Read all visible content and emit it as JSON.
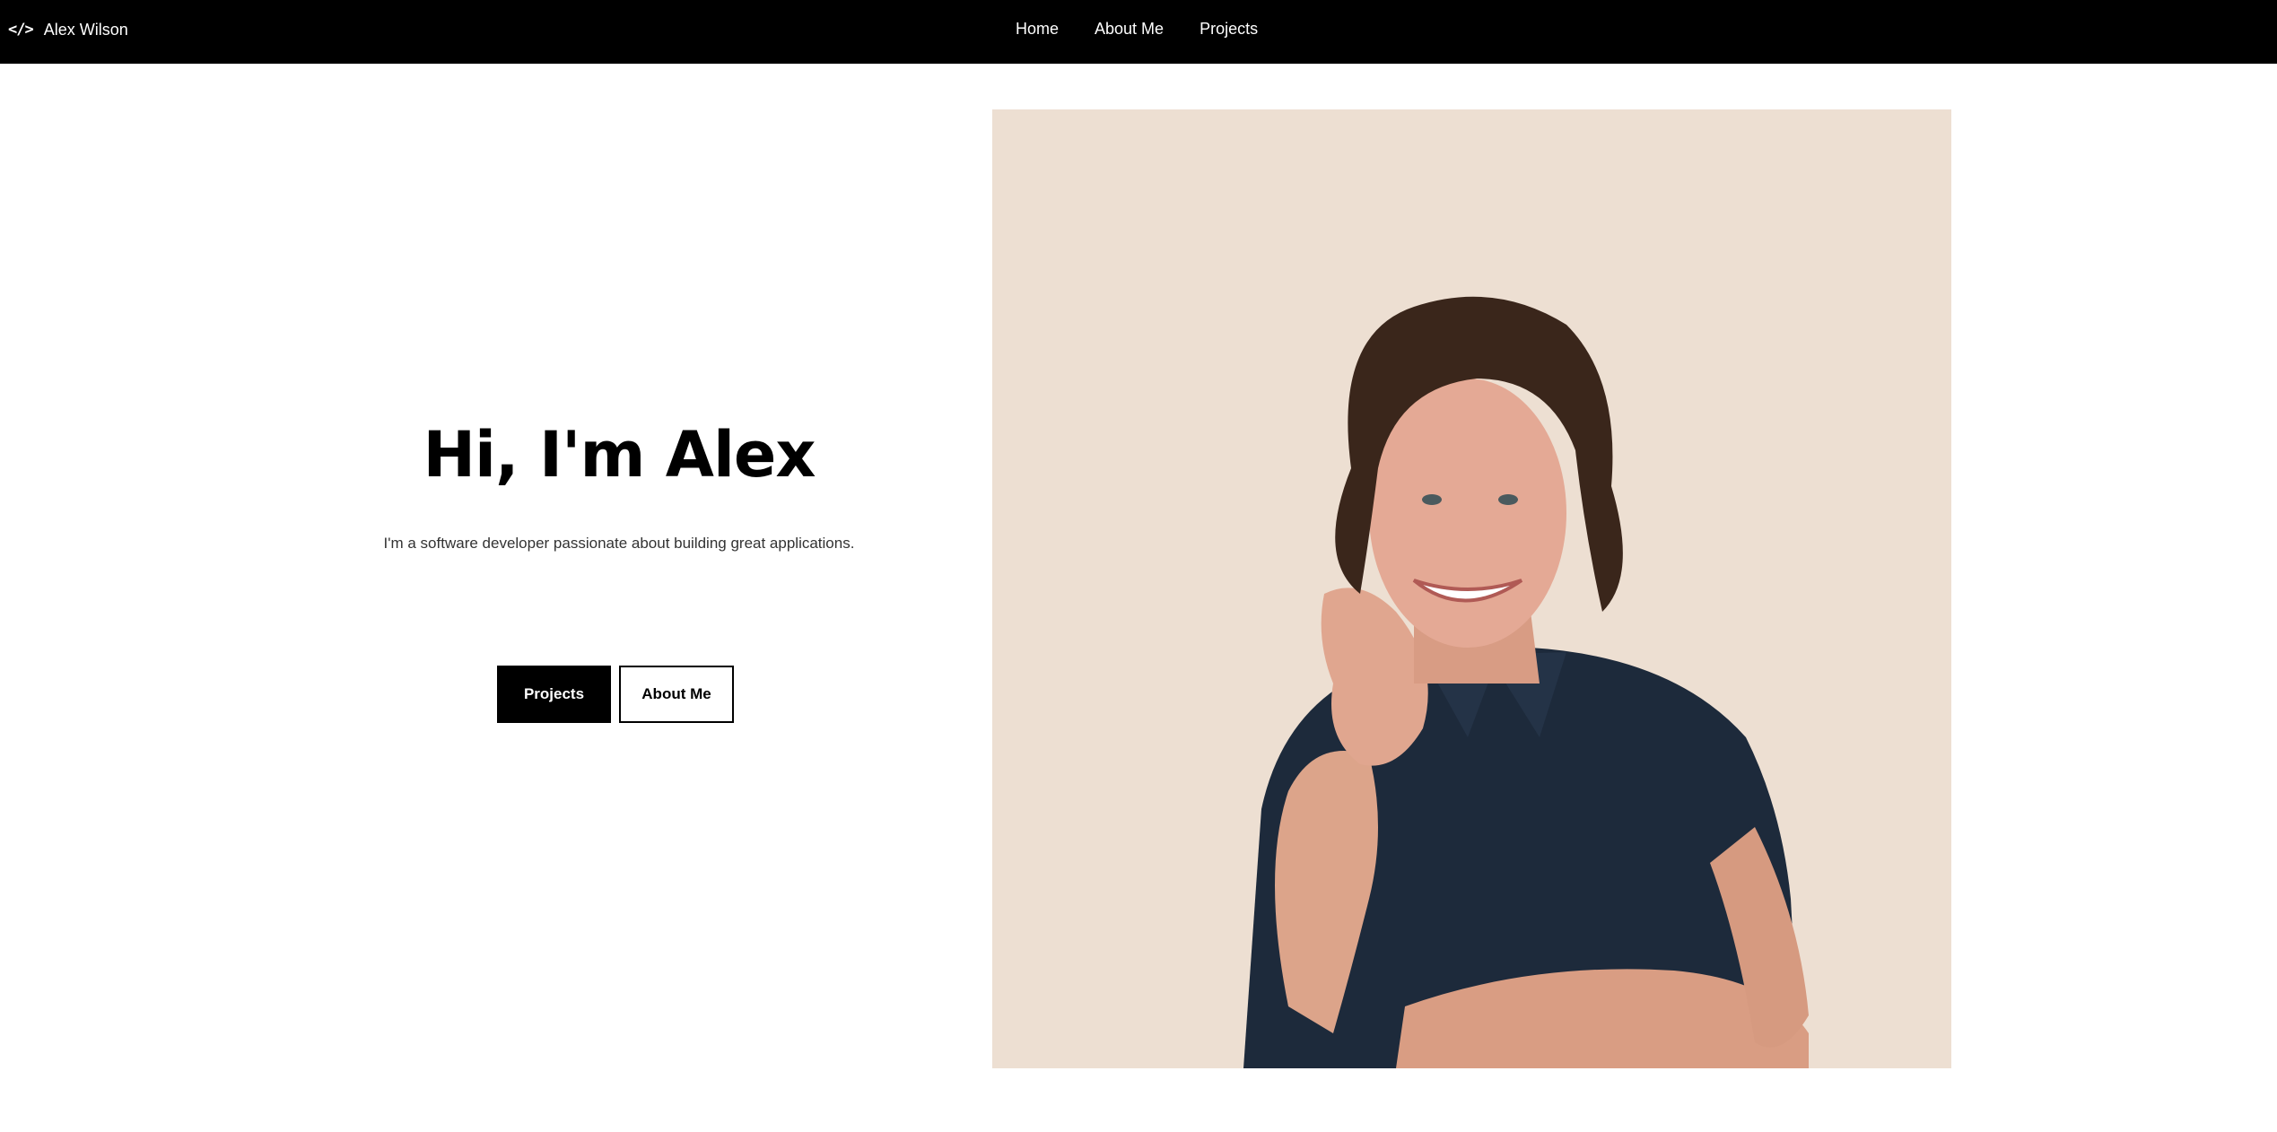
{
  "nav": {
    "brand_icon": "</>",
    "brand_name": "Alex Wilson",
    "links": [
      "Home",
      "About Me",
      "Projects"
    ]
  },
  "hero": {
    "title": "Hi, I'm Alex",
    "subtitle": "I'm a software developer passionate about building great applications.",
    "primary_button": "Projects",
    "secondary_button": "About Me"
  },
  "portrait": {
    "background_color": "#eddfd2"
  }
}
